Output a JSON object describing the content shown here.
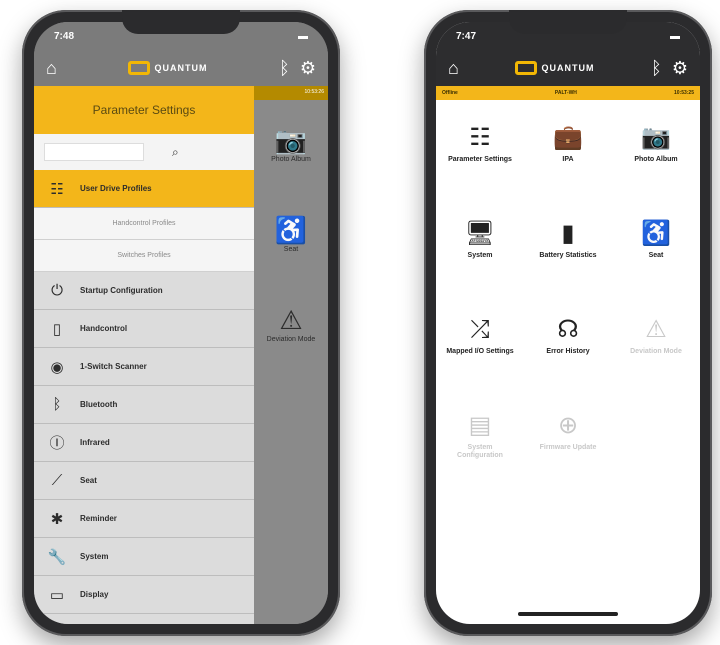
{
  "left": {
    "status_time": "7:48",
    "logo_text": "QUANTUM",
    "drawer_title": "Parameter Settings",
    "overlay_head": "10:53:26",
    "overlay_tiles": [
      {
        "label": "Photo Album",
        "icon": "camera-icon",
        "glyph": "📷"
      },
      {
        "label": "Seat",
        "icon": "wheelchair-icon",
        "glyph": "♿"
      },
      {
        "label": "Deviation Mode",
        "icon": "warning-icon",
        "glyph": "⚠"
      }
    ],
    "items": [
      {
        "label": "User Drive Profiles",
        "icon": "sliders-icon",
        "glyph": "☷",
        "active": true
      },
      {
        "label": "Startup Configuration",
        "icon": "power-icon",
        "glyph": "⏻"
      },
      {
        "label": "Handcontrol",
        "icon": "joystick-icon",
        "glyph": "▯"
      },
      {
        "label": "1-Switch Scanner",
        "icon": "record-icon",
        "glyph": "◉"
      },
      {
        "label": "Bluetooth",
        "icon": "bluetooth-icon",
        "glyph": "ᛒ"
      },
      {
        "label": "Infrared",
        "icon": "infrared-icon",
        "glyph": "Ⓘ"
      },
      {
        "label": "Seat",
        "icon": "seat-icon",
        "glyph": "⟋"
      },
      {
        "label": "Reminder",
        "icon": "reminder-icon",
        "glyph": "✱"
      },
      {
        "label": "System",
        "icon": "wrench-icon",
        "glyph": "🔧"
      },
      {
        "label": "Display",
        "icon": "monitor-icon",
        "glyph": "▭"
      }
    ],
    "subitems": [
      "Handcontrol Profiles",
      "Switches Profiles"
    ]
  },
  "right": {
    "status_time": "7:47",
    "logo_text": "QUANTUM",
    "status_left": "Offline",
    "status_center": "PALT-WH",
    "status_right": "10:53:25",
    "tiles": [
      {
        "label": "Parameter Settings",
        "icon": "sliders-icon",
        "glyph": "☷",
        "enabled": true
      },
      {
        "label": "IPA",
        "icon": "briefcase-icon",
        "glyph": "💼",
        "enabled": true
      },
      {
        "label": "Photo Album",
        "icon": "camera-icon",
        "glyph": "📷",
        "enabled": true
      },
      {
        "label": "System",
        "icon": "monitor-icon",
        "glyph": "🖥",
        "enabled": true
      },
      {
        "label": "Battery Statistics",
        "icon": "battery-icon",
        "glyph": "▮",
        "enabled": true
      },
      {
        "label": "Seat",
        "icon": "wheelchair-icon",
        "glyph": "♿",
        "enabled": true
      },
      {
        "label": "Mapped I/O Settings",
        "icon": "shuffle-icon",
        "glyph": "⤮",
        "enabled": true
      },
      {
        "label": "Error History",
        "icon": "stethoscope-icon",
        "glyph": "☊",
        "enabled": true
      },
      {
        "label": "Deviation Mode",
        "icon": "warning-icon",
        "glyph": "⚠",
        "enabled": false
      },
      {
        "label": "System Configuration",
        "icon": "document-icon",
        "glyph": "▤",
        "enabled": false
      },
      {
        "label": "Firmware Update",
        "icon": "download-icon",
        "glyph": "⊕",
        "enabled": false
      }
    ]
  }
}
